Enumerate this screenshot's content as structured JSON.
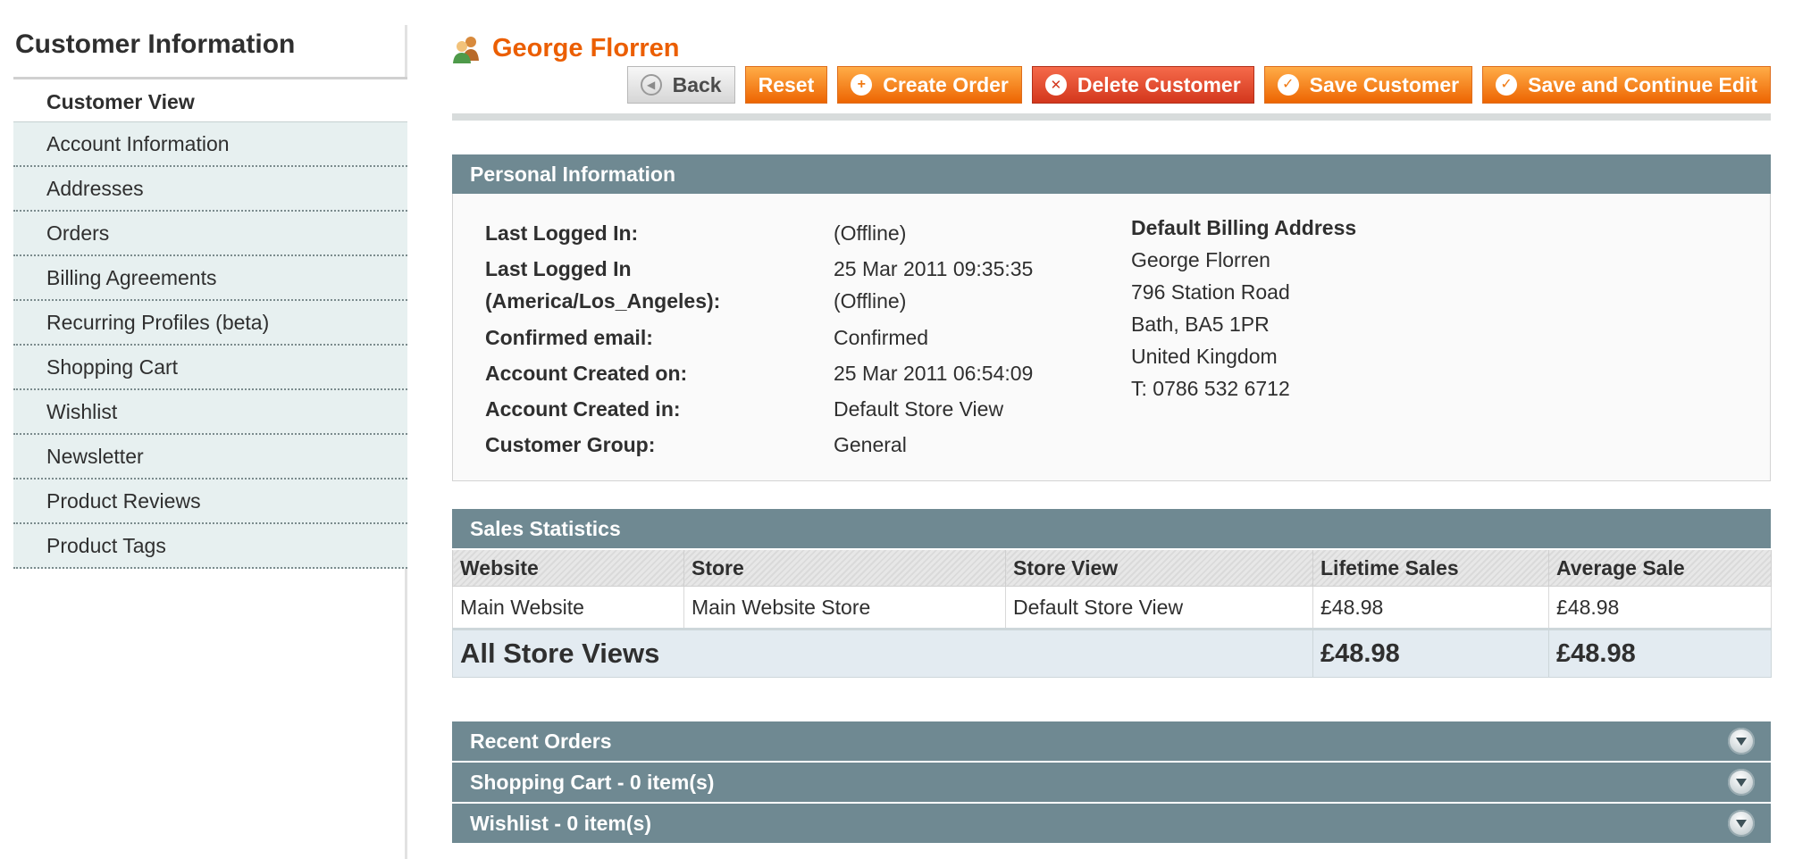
{
  "sidebar": {
    "title": "Customer Information",
    "items": [
      {
        "label": "Customer View",
        "active": true
      },
      {
        "label": "Account Information"
      },
      {
        "label": "Addresses"
      },
      {
        "label": "Orders"
      },
      {
        "label": "Billing Agreements"
      },
      {
        "label": "Recurring Profiles (beta)"
      },
      {
        "label": "Shopping Cart"
      },
      {
        "label": "Wishlist"
      },
      {
        "label": "Newsletter"
      },
      {
        "label": "Product Reviews"
      },
      {
        "label": "Product Tags"
      }
    ]
  },
  "header": {
    "title": "George Florren",
    "icon": "customer-icon",
    "buttons": {
      "back": "Back",
      "reset": "Reset",
      "create_order": "Create Order",
      "delete_customer": "Delete Customer",
      "save_customer": "Save Customer",
      "save_continue": "Save and Continue Edit"
    }
  },
  "personal_information": {
    "title": "Personal Information",
    "rows": [
      {
        "label": "Last Logged In:",
        "value": "(Offline)"
      },
      {
        "label_line1": "Last Logged In",
        "label_line2": "(America/Los_Angeles):",
        "value_line1": "25 Mar 2011 09:35:35",
        "value_line2": "(Offline)"
      },
      {
        "label": "Confirmed email:",
        "value": "Confirmed"
      },
      {
        "label": "Account Created on:",
        "value": "25 Mar 2011 06:54:09"
      },
      {
        "label": "Account Created in:",
        "value": "Default Store View"
      },
      {
        "label": "Customer Group:",
        "value": "General"
      }
    ],
    "billing_address": {
      "title": "Default Billing Address",
      "lines": [
        "George Florren",
        "796 Station Road",
        "Bath, BA5 1PR",
        "United Kingdom",
        "T: 0786 532 6712"
      ]
    }
  },
  "sales_statistics": {
    "title": "Sales Statistics",
    "columns": [
      "Website",
      "Store",
      "Store View",
      "Lifetime Sales",
      "Average Sale"
    ],
    "rows": [
      [
        "Main Website",
        "Main Website Store",
        "Default Store View",
        "£48.98",
        "£48.98"
      ]
    ],
    "total": {
      "label": "All Store Views",
      "lifetime_sales": "£48.98",
      "average_sale": "£48.98"
    }
  },
  "collapsible_sections": [
    {
      "title": "Recent Orders"
    },
    {
      "title": "Shopping Cart - 0 item(s)"
    },
    {
      "title": "Wishlist - 0 item(s)"
    }
  ],
  "colors": {
    "accent": "#eb5e00",
    "section_header": "#6f8992",
    "delete_button": "#d3371d",
    "sidebar_bg": "#e7f0f0"
  }
}
